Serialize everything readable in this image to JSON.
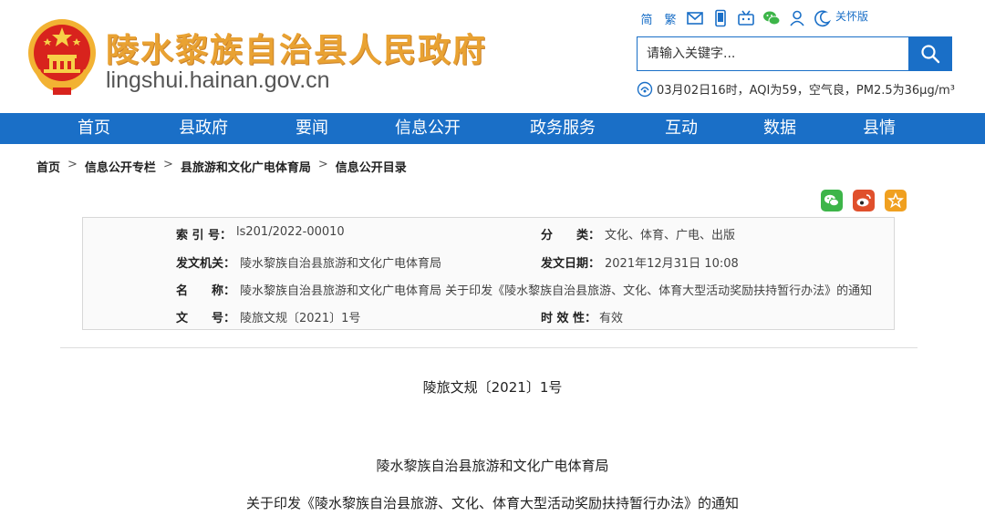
{
  "header": {
    "site_title": "陵水黎族自治县人民政府",
    "site_domain": "lingshui.hainan.gov.cn",
    "tools": {
      "simplified": "简",
      "traditional": "繁",
      "care_mode": "关怀版"
    },
    "search": {
      "placeholder": "请输入关键字..."
    },
    "weather": "03月02日16时，AQI为59，空气良，PM2.5为36μg/m³"
  },
  "nav": {
    "items": [
      {
        "label": "首页"
      },
      {
        "label": "县政府"
      },
      {
        "label": "要闻"
      },
      {
        "label": "信息公开"
      },
      {
        "label": "政务服务"
      },
      {
        "label": "互动"
      },
      {
        "label": "数据"
      },
      {
        "label": "县情"
      }
    ]
  },
  "breadcrumb": {
    "items": [
      "首页",
      "信息公开专栏",
      "县旅游和文化广电体育局",
      "信息公开目录"
    ],
    "separator": ">"
  },
  "info": {
    "index_label": "索 引 号：",
    "index_value": "ls201/2022-00010",
    "category_label": "分　　类：",
    "category_value": "文化、体育、广电、出版",
    "issuer_label": "发文机关：",
    "issuer_value": "陵水黎族自治县旅游和文化广电体育局",
    "date_label": "发文日期：",
    "date_value": "2021年12月31日 10:08",
    "name_label": "名　　称：",
    "name_value": "陵水黎族自治县旅游和文化广电体育局 关于印发《陵水黎族自治县旅游、文化、体育大型活动奖励扶持暂行办法》的通知",
    "docno_label": "文　　号：",
    "docno_value": "陵旅文规〔2021〕1号",
    "validity_label": "时 效 性：",
    "validity_value": "有效"
  },
  "document": {
    "doc_number": "陵旅文规〔2021〕1号",
    "agency": "陵水黎族自治县旅游和文化广电体育局",
    "title": "关于印发《陵水黎族自治县旅游、文化、体育大型活动奖励扶持暂行办法》的通知"
  },
  "colors": {
    "brand_blue": "#1a6fc7",
    "title_gold": "#e9a232",
    "wechat_green": "#3db549",
    "weibo_red": "#e0502c",
    "favorite_orange": "#f0a020"
  }
}
